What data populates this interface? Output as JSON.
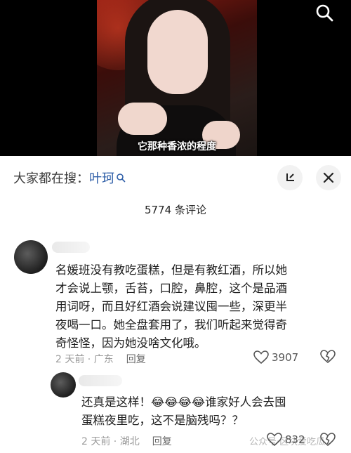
{
  "video": {
    "caption": "它那种香浓的程度"
  },
  "sheet": {
    "search_prefix": "大家都在搜：",
    "search_keyword": "叶珂",
    "comment_count": "5774 条评论"
  },
  "comments": [
    {
      "lines": [
        "名媛班没有教吃蛋糕，但是有教红酒，所以她",
        "才会说上颚，舌苔，口腔，鼻腔，这个是品酒",
        "用词呀，而且好红酒会说建议囤一些，深更半",
        "夜喝一口。她全盘套用了，我们听起来觉得奇",
        "奇怪怪，因为她没啥文化哦。"
      ],
      "time_location": "2 天前 · 广东",
      "reply_label": "回复",
      "likes": "3907"
    },
    {
      "lines": [
        "还真是这样！😂😂😂😂谁家好人会去囤",
        "蛋糕夜里吃，这不是脑残吗？？"
      ],
      "time_location": "2 天前 · 湖北",
      "reply_label": "回复",
      "likes": "832"
    }
  ],
  "watermark": "公众号·区块爱吃瓜"
}
